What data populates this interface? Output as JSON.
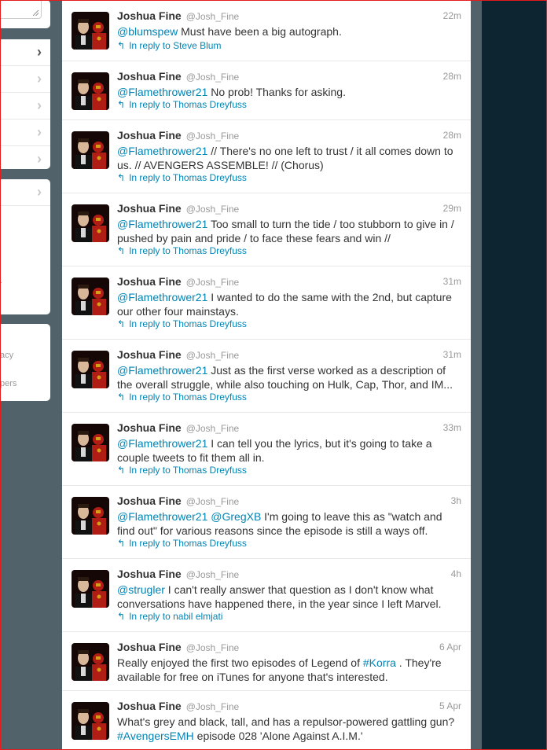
{
  "sidebar": {
    "footer_items": [
      "acy",
      "pers"
    ]
  },
  "avatar_colors": {
    "bg": "#140706",
    "suit_red": "#b01d14",
    "gold": "#d4a017",
    "face": "#d9b89a",
    "hair": "#2a1a10",
    "jacket": "#111111",
    "shirt": "#d8d8d8"
  },
  "tweets": [
    {
      "name": "Joshua Fine",
      "handle": "@Josh_Fine",
      "time": "22m",
      "mention": "@blumspew",
      "body": " Must have been a big autograph.",
      "reply": "In reply to Steve Blum"
    },
    {
      "name": "Joshua Fine",
      "handle": "@Josh_Fine",
      "time": "28m",
      "mention": "@Flamethrower21",
      "body": " No prob! Thanks for asking.",
      "reply": "In reply to Thomas Dreyfuss"
    },
    {
      "name": "Joshua Fine",
      "handle": "@Josh_Fine",
      "time": "28m",
      "mention": "@Flamethrower21",
      "body": " // There's no one left to trust / it all comes down to us. // AVENGERS ASSEMBLE! // (Chorus)",
      "reply": "In reply to Thomas Dreyfuss"
    },
    {
      "name": "Joshua Fine",
      "handle": "@Josh_Fine",
      "time": "29m",
      "mention": "@Flamethrower21",
      "body": " Too small to turn the tide / too stubborn to give in / pushed by pain and pride / to face these fears and win //",
      "reply": "In reply to Thomas Dreyfuss"
    },
    {
      "name": "Joshua Fine",
      "handle": "@Josh_Fine",
      "time": "31m",
      "mention": "@Flamethrower21",
      "body": " I wanted to do the same with the 2nd, but capture our other four mainstays.",
      "reply": "In reply to Thomas Dreyfuss"
    },
    {
      "name": "Joshua Fine",
      "handle": "@Josh_Fine",
      "time": "31m",
      "mention": "@Flamethrower21",
      "body": " Just as the first verse worked as a description of the overall struggle, while also touching on Hulk, Cap, Thor, and IM...",
      "reply": "In reply to Thomas Dreyfuss"
    },
    {
      "name": "Joshua Fine",
      "handle": "@Josh_Fine",
      "time": "33m",
      "mention": "@Flamethrower21",
      "body": " I can tell you the lyrics, but it's going to take a couple tweets to fit them all in.",
      "reply": "In reply to Thomas Dreyfuss"
    },
    {
      "name": "Joshua Fine",
      "handle": "@Josh_Fine",
      "time": "3h",
      "mention": "@Flamethrower21",
      "mention2": "@GregXB",
      "body": " I'm going to leave this as \"watch and find out\" for various reasons since the episode is still a ways off.",
      "reply": "In reply to Thomas Dreyfuss"
    },
    {
      "name": "Joshua Fine",
      "handle": "@Josh_Fine",
      "time": "4h",
      "mention": "@strugler",
      "body": " I can't really answer that question as I don't know what conversations have happened there, in the year since I left Marvel.",
      "reply": "In reply to nabil elmjati"
    },
    {
      "name": "Joshua Fine",
      "handle": "@Josh_Fine",
      "time": "6 Apr",
      "body_before": "Really enjoyed the first two episodes of Legend of ",
      "hashtag": "#Korra",
      "body_after": " . They're available for free on iTunes for anyone that's interested."
    },
    {
      "name": "Joshua Fine",
      "handle": "@Josh_Fine",
      "time": "5 Apr",
      "body_before": "What's grey and black, tall, and has a repulsor-powered gattling gun? ",
      "hashtag": "#AvengersEMH",
      "body_after": " episode 028 'Alone Against A.I.M.'"
    }
  ]
}
